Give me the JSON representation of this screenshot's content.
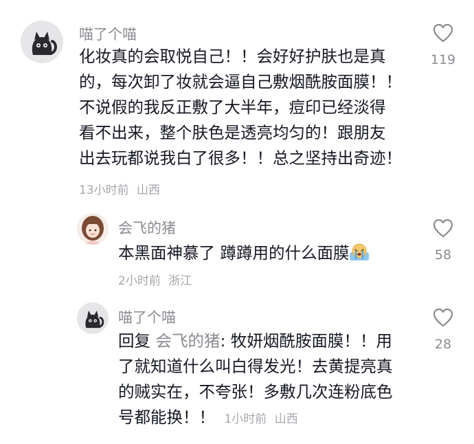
{
  "comments": [
    {
      "username": "喵了个喵",
      "avatar_icon": "black-cat-avatar",
      "text_lines": [
        "化妆真的会取悦自己！！会好好护肤也是真",
        "的，每次卸了妆就会逼自己敷烟酰胺面膜！！",
        "不说假的我反正敷了大半年，痘印已经淡得",
        "看不出来，整个肤色是透亮均匀的！跟朋友",
        "出去玩都说我白了很多！！总之坚持出奇迹！"
      ],
      "time": "13小时前",
      "location": "山西",
      "likes": "119"
    }
  ],
  "replies": [
    {
      "username": "会飞的猪",
      "avatar_icon": "girl-avatar",
      "text": "本黑面神慕了 蹲蹲用的什么面膜",
      "emoji": "crying-face-emoji",
      "time": "2小时前",
      "location": "浙江",
      "likes": "58"
    },
    {
      "username": "喵了个喵",
      "avatar_icon": "black-cat-avatar",
      "reply_prefix": "回复",
      "reply_target": "会飞的猪",
      "text_lines": [
        ": 牧妍烟酰胺面膜！！用",
        "了就知道什么叫白得发光！去黄提亮真",
        "的贼实在，不夸张！多敷几次连粉底色",
        "号都能换！！"
      ],
      "time": "1小时前",
      "location": "山西",
      "likes": "28"
    }
  ],
  "colors": {
    "text": "#161823",
    "username": "#8a8b91",
    "meta": "#a5a6ab",
    "background": "#ffffff"
  }
}
